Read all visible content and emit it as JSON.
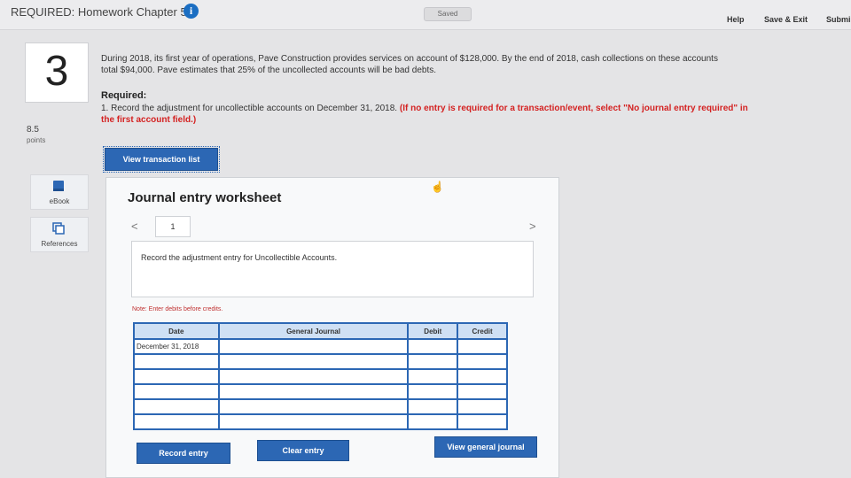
{
  "header": {
    "title": "REQUIRED: Homework Chapter 5",
    "info_icon": "info-icon",
    "saved": "Saved",
    "help": "Help",
    "save_exit": "Save & Exit",
    "submit": "Submi"
  },
  "question": {
    "number": "3",
    "points_value": "8.5",
    "points_label": "points",
    "text": "During 2018, its first year of operations, Pave Construction provides services on account of $128,000. By the end of 2018, cash collections on these accounts total $94,000. Pave estimates that 25% of the uncollected accounts will be bad debts.",
    "required_heading": "Required:",
    "required_text": "1. Record the adjustment for uncollectible accounts on December 31, 2018.",
    "required_note": "(If no entry is required for a transaction/event, select \"No journal entry required\" in the first account field.)"
  },
  "sidebar": {
    "ebook": "eBook",
    "references": "References"
  },
  "buttons": {
    "view_transaction_list": "View transaction list",
    "record_entry": "Record entry",
    "clear_entry": "Clear entry",
    "view_general_journal": "View general journal"
  },
  "worksheet": {
    "title": "Journal entry worksheet",
    "prev": "<",
    "next": ">",
    "page": "1",
    "instruction": "Record the adjustment entry for Uncollectible Accounts.",
    "note": "Note: Enter debits before credits.",
    "columns": [
      "Date",
      "General Journal",
      "Debit",
      "Credit"
    ],
    "rows": [
      [
        "December 31, 2018",
        "",
        "",
        ""
      ],
      [
        "",
        "",
        "",
        ""
      ],
      [
        "",
        "",
        "",
        ""
      ],
      [
        "",
        "",
        "",
        ""
      ],
      [
        "",
        "",
        "",
        ""
      ],
      [
        "",
        "",
        "",
        ""
      ]
    ]
  },
  "colors": {
    "accent": "#2c67b4",
    "note_red": "#d42222"
  }
}
